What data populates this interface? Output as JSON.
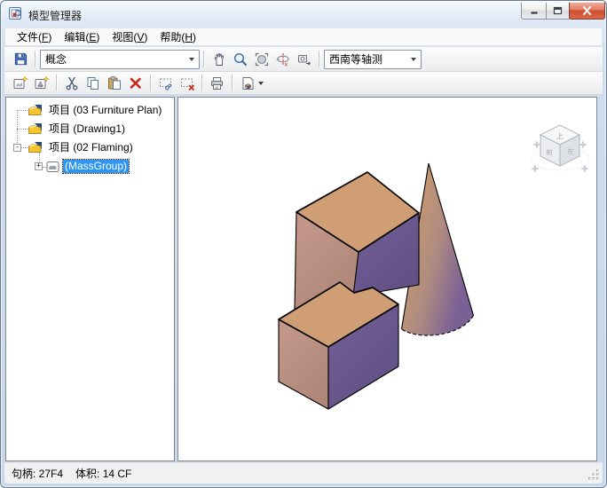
{
  "window": {
    "title": "模型管理器"
  },
  "menu_bar": {
    "items": [
      {
        "pre": "文件(",
        "key": "F",
        "post": ")"
      },
      {
        "pre": "编辑(",
        "key": "E",
        "post": ")"
      },
      {
        "pre": "视图(",
        "key": "V",
        "post": ")"
      },
      {
        "pre": "帮助(",
        "key": "H",
        "post": ")"
      }
    ]
  },
  "toolbar_primary": {
    "visual_style_combo": {
      "value": "概念"
    },
    "view_combo": {
      "value": "西南等轴测"
    }
  },
  "tree": {
    "items": [
      {
        "label": "项目 (03 Furniture Plan)"
      },
      {
        "label": "项目 (Drawing1)"
      },
      {
        "label": "项目 (02 Flaming)",
        "expander": "-"
      },
      {
        "label": "(MassGroup)",
        "expander": "+",
        "selected": true
      }
    ]
  },
  "viewport": {
    "viewcube": {
      "top_label": "上",
      "left_label": "前",
      "right_label": "左"
    },
    "scene": {
      "description": "两个长方体与一个圆锥体（概念视觉样式，西南等轴测）",
      "colors": {
        "box_top": "#CF9E74",
        "box_left": "#C59A8C",
        "box_left_dark": "#AF8779",
        "box_right": "#73609A",
        "box_right_dark": "#615083",
        "cone_tan": "#C9986F",
        "cone_mid": "#B08C80",
        "cone_purple": "#7B6095",
        "edge": "#000000"
      }
    }
  },
  "status_bar": {
    "handle": "句柄: 27F4",
    "volume": "体积: 14 CF"
  }
}
